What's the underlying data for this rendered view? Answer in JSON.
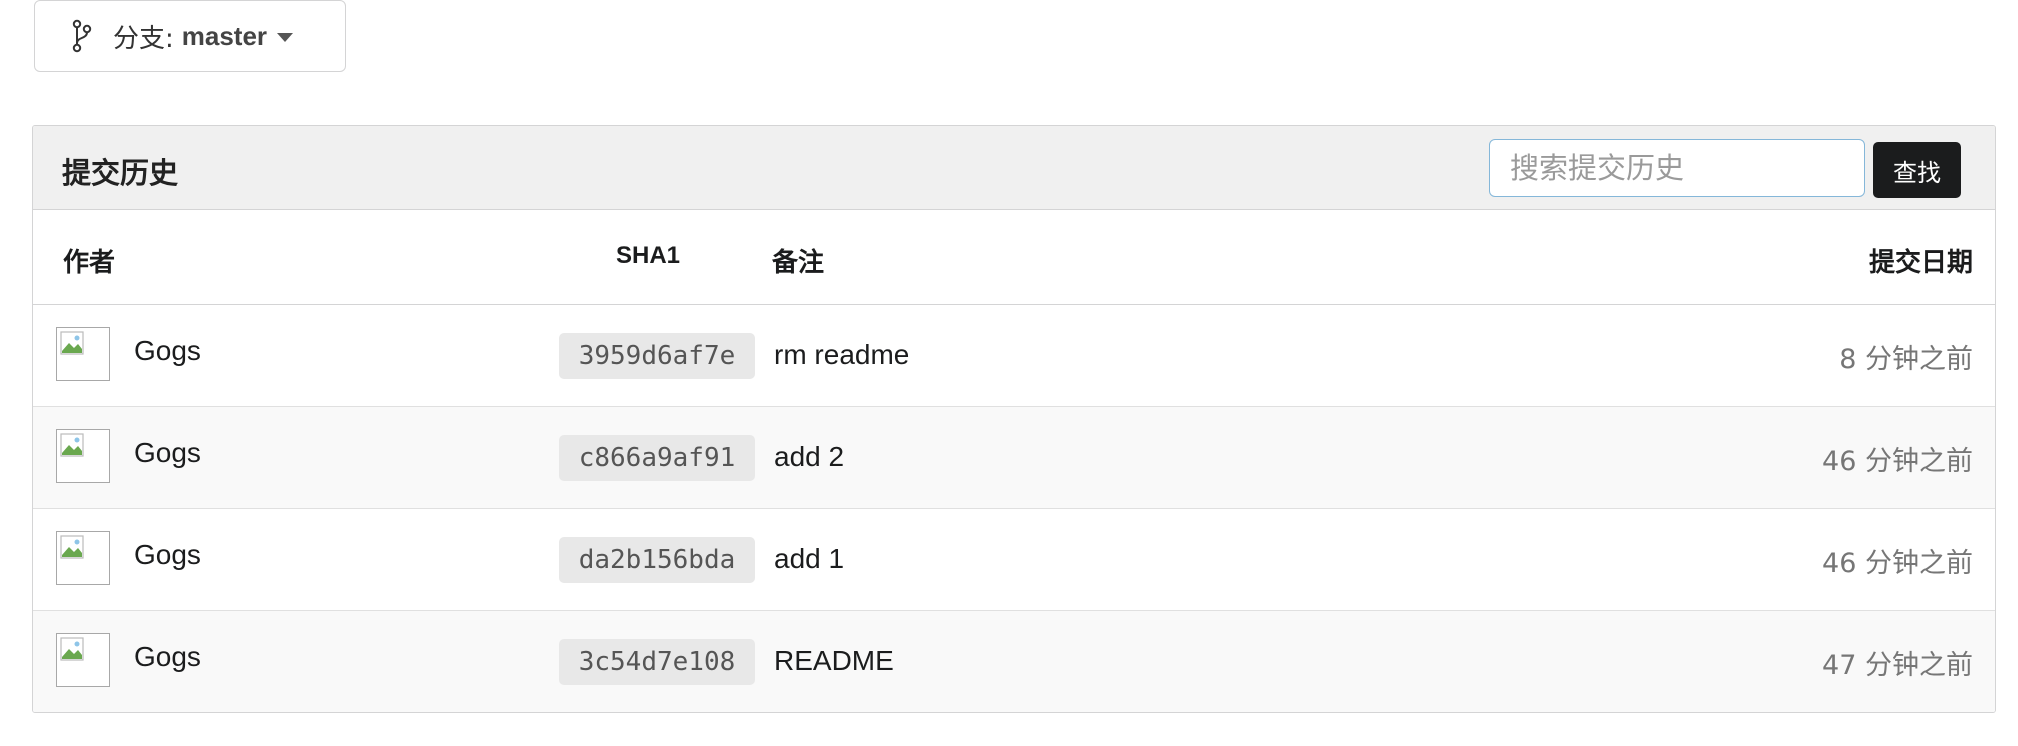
{
  "branch": {
    "prefix": "分支:",
    "name": "master",
    "icon": "branch-icon"
  },
  "commits_header": {
    "title": "提交历史",
    "search_placeholder": "搜索提交历史",
    "search_value": "",
    "search_button": "查找"
  },
  "columns": {
    "author": "作者",
    "sha": "SHA1",
    "message": "备注",
    "date": "提交日期"
  },
  "commits": [
    {
      "author": "Gogs",
      "sha": "3959d6af7e",
      "message": "rm readme",
      "date": "8 分钟之前"
    },
    {
      "author": "Gogs",
      "sha": "c866a9af91",
      "message": "add 2",
      "date": "46 分钟之前"
    },
    {
      "author": "Gogs",
      "sha": "da2b156bda",
      "message": "add 1",
      "date": "46 分钟之前"
    },
    {
      "author": "Gogs",
      "sha": "3c54d7e108",
      "message": "README",
      "date": "47 分钟之前"
    }
  ],
  "colors": {
    "search_border": "#85b7d9",
    "button_bg": "#1b1c1d",
    "header_bg": "#f0f0f0",
    "sha_bg": "#e8e8e8",
    "date_text": "#767676"
  }
}
